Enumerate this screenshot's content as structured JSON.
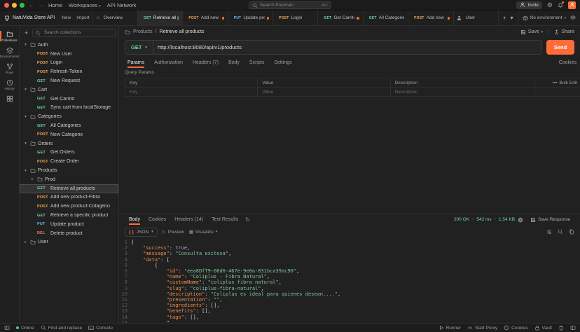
{
  "colors": {
    "accent": "#ff6c37",
    "method_get": "#6bdd9a",
    "method_post": "#f0a750",
    "method_put": "#74aef6",
    "method_delete": "#f47a63",
    "status_ok": "#6bdd9a"
  },
  "titlebar": {
    "home": "Home",
    "workspaces": "Workspaces",
    "api_network": "API Network",
    "search_placeholder": "Search Postman",
    "search_shortcut": "⌘K",
    "invite_label": "Invite"
  },
  "workspace": {
    "name": "NatuVida Store API",
    "new_label": "New",
    "import_label": "Import",
    "environment": "No environment",
    "tabs": [
      {
        "icon": "overview",
        "label": "Overview"
      },
      {
        "method": "GET",
        "label": "Retrieve all produ",
        "active": true
      },
      {
        "method": "POST",
        "label": "Add new produc",
        "dirty": true
      },
      {
        "method": "PUT",
        "label": "Update produc",
        "dirty": true
      },
      {
        "method": "POST",
        "label": "Login"
      },
      {
        "method": "GET",
        "label": "Get Carrito",
        "dirty": true
      },
      {
        "method": "GET",
        "label": "All Categories"
      },
      {
        "method": "POST",
        "label": "Add new produ",
        "dirty": true
      },
      {
        "icon": "user",
        "label": "User"
      }
    ]
  },
  "rail": {
    "labels": [
      "Collections",
      "Environments",
      "Flows",
      "History"
    ]
  },
  "sidebar": {
    "search_placeholder": "Search collections",
    "tree": [
      {
        "type": "folder",
        "label": "Auth"
      },
      {
        "type": "req",
        "method": "POST",
        "label": "New User",
        "depth": 1
      },
      {
        "type": "req",
        "method": "POST",
        "label": "Login",
        "depth": 1
      },
      {
        "type": "req",
        "method": "POST",
        "label": "Refresh-Token",
        "depth": 1
      },
      {
        "type": "req",
        "method": "GET",
        "label": "New Request",
        "depth": 1
      },
      {
        "type": "folder",
        "label": "Cart"
      },
      {
        "type": "req",
        "method": "GET",
        "label": "Get Carrito",
        "depth": 1
      },
      {
        "type": "req",
        "method": "GET",
        "label": "Sync cart from localStorage",
        "depth": 1
      },
      {
        "type": "folder",
        "label": "Categories"
      },
      {
        "type": "req",
        "method": "GET",
        "label": "All Categories",
        "depth": 1
      },
      {
        "type": "req",
        "method": "POST",
        "label": "New Categorie",
        "depth": 1
      },
      {
        "type": "folder",
        "label": "Orders"
      },
      {
        "type": "req",
        "method": "GET",
        "label": "Get Orders",
        "depth": 1
      },
      {
        "type": "req",
        "method": "POST",
        "label": "Create Order",
        "depth": 1
      },
      {
        "type": "folder",
        "label": "Products"
      },
      {
        "type": "folder",
        "label": "Prod",
        "depth": 1,
        "collapsed": true
      },
      {
        "type": "req",
        "method": "GET",
        "label": "Retrieve all products",
        "depth": 1,
        "selected": true
      },
      {
        "type": "req",
        "method": "POST",
        "label": "Add new product-Fibra",
        "depth": 1
      },
      {
        "type": "req",
        "method": "POST",
        "label": "Add new product-Colágeno",
        "depth": 1
      },
      {
        "type": "req",
        "method": "GET",
        "label": "Retrieve a specific product",
        "depth": 1
      },
      {
        "type": "req",
        "method": "PUT",
        "label": "Update product",
        "depth": 1
      },
      {
        "type": "req",
        "method": "DEL",
        "label": "Delete product",
        "depth": 1
      },
      {
        "type": "folder",
        "label": "User",
        "collapsed": true
      }
    ]
  },
  "request": {
    "breadcrumb_collection": "Products",
    "breadcrumb_name": "Retrieve all products",
    "save_label": "Save",
    "share_label": "Share",
    "method": "GET",
    "url": "http://localhost:8080/api/v1/products",
    "send_label": "Send",
    "tabs": [
      {
        "label": "Params",
        "active": true
      },
      {
        "label": "Authorization"
      },
      {
        "label": "Headers (7)"
      },
      {
        "label": "Body"
      },
      {
        "label": "Scripts"
      },
      {
        "label": "Settings"
      }
    ],
    "cookies_link": "Cookies",
    "section_title": "Query Params",
    "params_headers": [
      "Key",
      "Value",
      "Description"
    ],
    "bulk_edit_label": "Bulk Edit",
    "placeholder_key": "Key",
    "placeholder_value": "Value",
    "placeholder_description": "Description"
  },
  "response": {
    "tabs": [
      {
        "label": "Body",
        "active": true
      },
      {
        "label": "Cookies"
      },
      {
        "label": "Headers (14)"
      },
      {
        "label": "Test Results"
      }
    ],
    "status": "200 OK",
    "time": "542 ms",
    "size": "1.54 KB",
    "save_response_label": "Save Response",
    "format_label": "JSON",
    "preview_label": "Preview",
    "visualize_label": "Visualize",
    "code_lines": [
      "{",
      "    \"success\": true,",
      "    \"message\": \"Consulta exitosa\",",
      "    \"data\": [",
      "        {",
      "            \"id\": \"eea8DfT9-08d6-467e-9e0a-831bca39ac90\",",
      "            \"name\": \"Coliplus - Fibra Natural\",",
      "            \"customName\": \"coliplus fibra natural\",",
      "            \"slug\": \"coliplus-fibra-natural\",",
      "            \"description\": \"Coliplus es ideal para quienes desean....\",",
      "            \"presentation\": \"\",",
      "            \"ingredients\": [],",
      "            \"benefits\": [],",
      "            \"tags\": [],",
      "            \""
    ]
  },
  "statusbar": {
    "online": "Online",
    "find_replace": "Find and replace",
    "console": "Console",
    "runner": "Runner",
    "start_proxy": "Start Proxy",
    "cookies": "Cookies",
    "vault": "Vault"
  }
}
